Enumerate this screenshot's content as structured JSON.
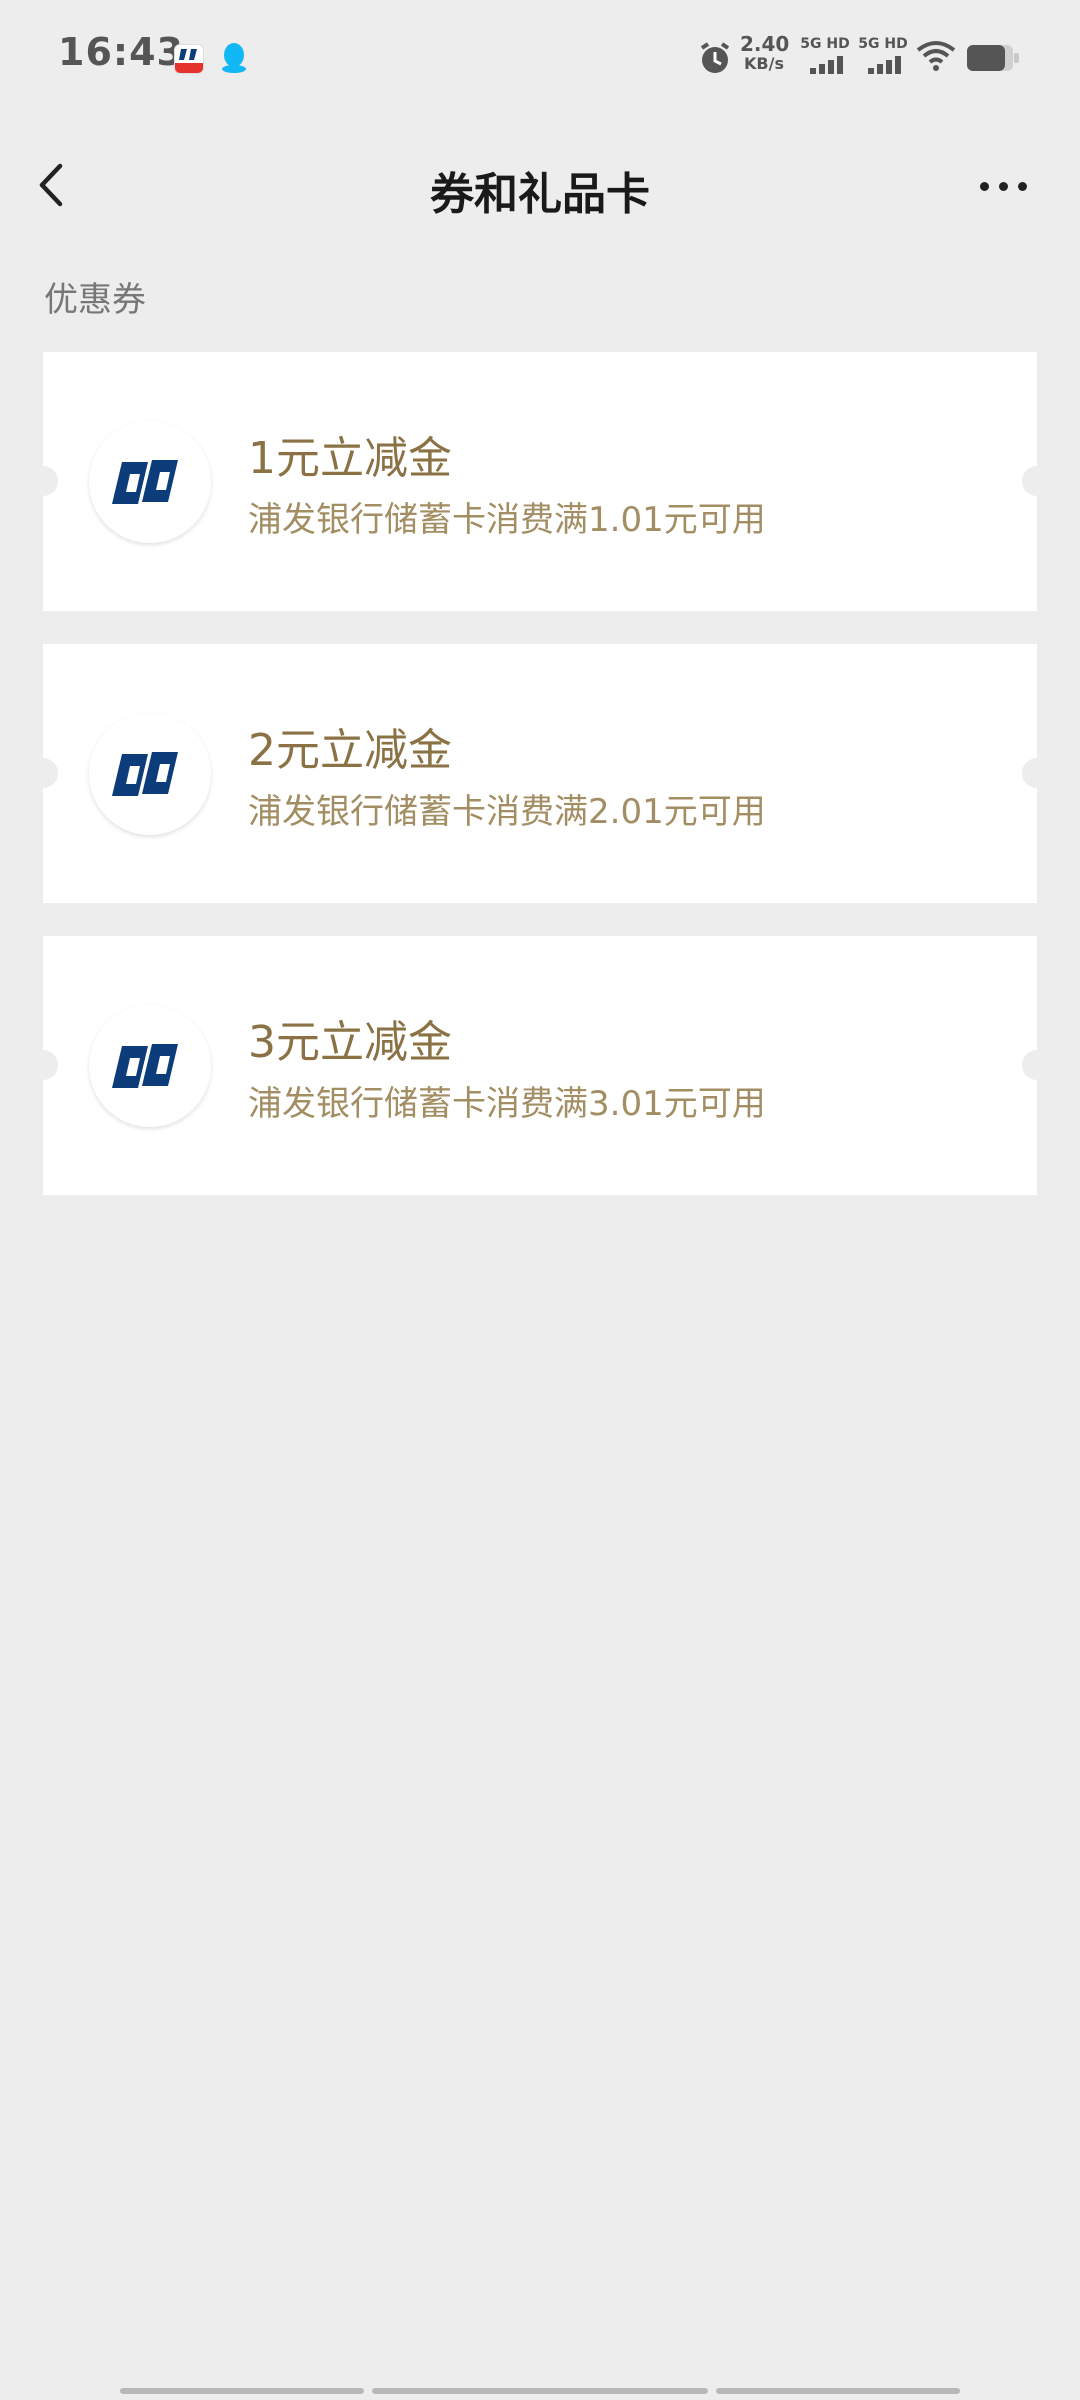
{
  "status_bar": {
    "time": "16:43",
    "net_speed_value": "2.40",
    "net_speed_unit": "KB/s",
    "sim1_label": "5G HD",
    "sim2_label": "5G HD",
    "icons": [
      "bank-app-icon",
      "qq-icon",
      "alarm-icon",
      "signal-icon",
      "wifi-icon",
      "battery-icon"
    ]
  },
  "header": {
    "title": "券和礼品卡",
    "back_icon": "chevron-left-icon",
    "more_icon": "more-horizontal-icon"
  },
  "section": {
    "title": "优惠券"
  },
  "coupons": [
    {
      "title": "1元立减金",
      "description": "浦发银行储蓄卡消费满1.01元可用"
    },
    {
      "title": "2元立减金",
      "description": "浦发银行储蓄卡消费满2.01元可用"
    },
    {
      "title": "3元立减金",
      "description": "浦发银行储蓄卡消费满3.01元可用"
    }
  ],
  "colors": {
    "background": "#ededed",
    "card": "#ffffff",
    "coupon_title": "#8b7245",
    "coupon_desc": "#a38e63",
    "logo_blue": "#0c3d7a"
  }
}
